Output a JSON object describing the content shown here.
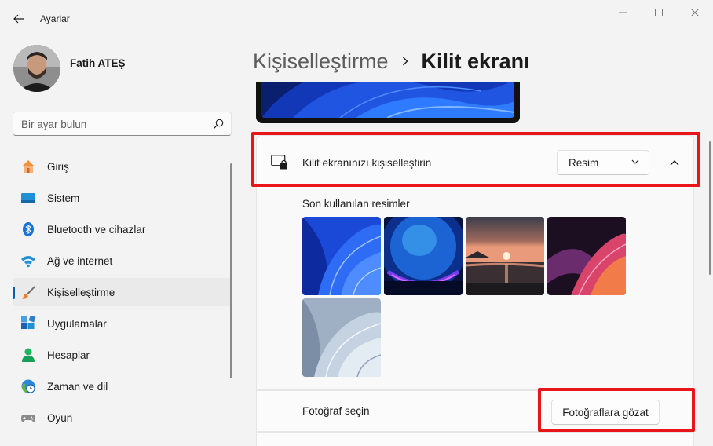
{
  "window": {
    "title": "Ayarlar"
  },
  "user": {
    "name": "Fatih ATEŞ"
  },
  "search": {
    "placeholder": "Bir ayar bulun"
  },
  "sidebar": {
    "items": [
      {
        "label": "Giriş",
        "icon": "home-icon"
      },
      {
        "label": "Sistem",
        "icon": "system-icon"
      },
      {
        "label": "Bluetooth ve cihazlar",
        "icon": "bluetooth-icon"
      },
      {
        "label": "Ağ ve internet",
        "icon": "wifi-icon"
      },
      {
        "label": "Kişiselleştirme",
        "icon": "brush-icon",
        "active": true
      },
      {
        "label": "Uygulamalar",
        "icon": "apps-icon"
      },
      {
        "label": "Hesaplar",
        "icon": "account-icon"
      },
      {
        "label": "Zaman ve dil",
        "icon": "time-language-icon"
      },
      {
        "label": "Oyun",
        "icon": "gamepad-icon"
      }
    ]
  },
  "header": {
    "parent": "Kişiselleştirme",
    "current": "Kilit ekranı"
  },
  "lockscreen": {
    "title": "Kilit ekranınızı kişiselleştirin",
    "dropdown_value": "Resim",
    "recent_label": "Son kullanılan resimler",
    "photo_label": "Fotoğraf seçin",
    "browse_button": "Fotoğraflara gözat"
  },
  "colors": {
    "accent": "#005fb8",
    "highlight": "#e8151b"
  }
}
